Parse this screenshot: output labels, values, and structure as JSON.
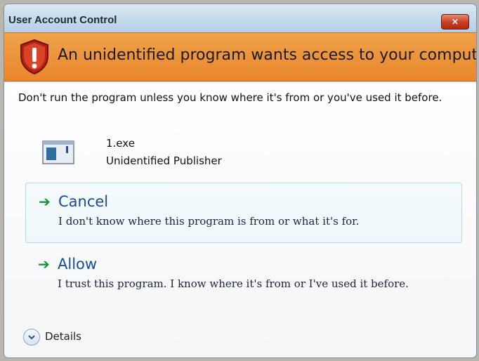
{
  "window": {
    "title": "User Account Control",
    "close_label": "×"
  },
  "banner": {
    "title": "An unidentified program wants access to your computer",
    "icon": "warning-shield-icon"
  },
  "content": {
    "warning": "Don't run the program unless you know where it's from or you've used it before.",
    "program": {
      "name": "1.exe",
      "publisher": "Unidentified Publisher",
      "icon": "program-icon"
    },
    "options": [
      {
        "title": "Cancel",
        "description": "I don't know where this program is from or what it's for."
      },
      {
        "title": "Allow",
        "description": "I trust this program. I know where it's from or I've used it before."
      }
    ],
    "details_label": "Details"
  },
  "colors": {
    "banner": "#e9862c",
    "option_title": "#1a4a9a",
    "arrow": "#1e8f3a",
    "close_button": "#c53d22"
  }
}
